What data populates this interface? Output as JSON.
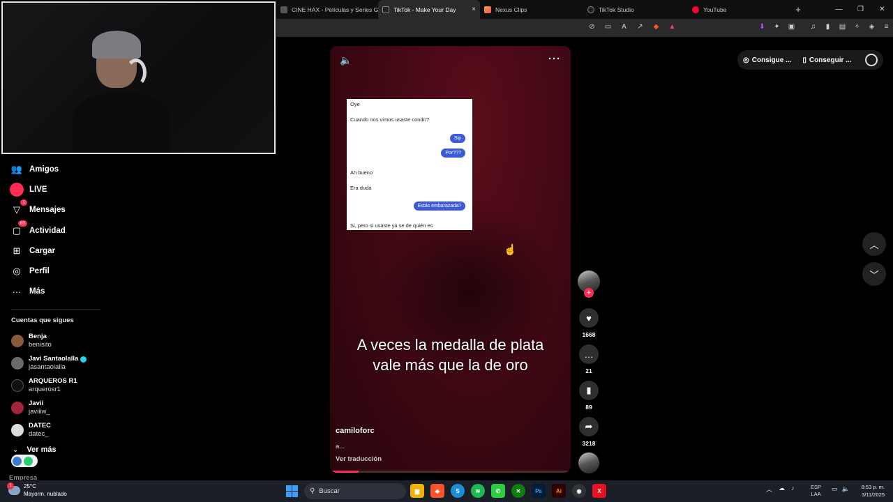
{
  "browser": {
    "tabs": [
      {
        "label": "CINE HAX - Películas y Series GRATIS",
        "icon": "cinehax-icon",
        "active": false
      },
      {
        "label": "TikTok - Make Your Day",
        "icon": "tiktok-icon",
        "active": true
      },
      {
        "label": "Nexus Clips",
        "icon": "nexus-icon",
        "active": false
      },
      {
        "label": "TikTok Studio",
        "icon": "tiktok-icon",
        "active": false
      },
      {
        "label": "YouTube",
        "icon": "youtube-icon",
        "active": false
      }
    ],
    "new_tab": "+",
    "close_tab": "×",
    "window_controls": [
      "—",
      "❐",
      "✕"
    ]
  },
  "sidebar": {
    "items": [
      {
        "label": "Amigos",
        "icon": "friends-icon",
        "badge": ""
      },
      {
        "label": "LIVE",
        "icon": "live-icon",
        "badge": ""
      },
      {
        "label": "Mensajes",
        "icon": "messages-icon",
        "badge": "1"
      },
      {
        "label": "Actividad",
        "icon": "activity-icon",
        "badge": "60"
      },
      {
        "label": "Cargar",
        "icon": "upload-icon",
        "badge": ""
      },
      {
        "label": "Perfil",
        "icon": "profile-icon",
        "badge": ""
      },
      {
        "label": "Más",
        "icon": "more-icon",
        "badge": ""
      }
    ],
    "following_title": "Cuentas que sigues",
    "following": [
      {
        "name": "Benja",
        "user": "benisito",
        "verified": false,
        "color": "#8b5a3c"
      },
      {
        "name": "Javi Santaolalla",
        "user": "jasantaolalla",
        "verified": true,
        "color": "#6a6a6a"
      },
      {
        "name": "ARQUEROS R1",
        "user": "arquerosr1",
        "verified": false,
        "color": "#111111"
      },
      {
        "name": "Javii",
        "user": "javiiiw_",
        "verified": false,
        "color": "#a3243a"
      },
      {
        "name": "DATEC",
        "user": "datec_",
        "verified": false,
        "color": "#dddddd"
      }
    ],
    "see_more": "Ver más",
    "empresa": "Empresa"
  },
  "video": {
    "chat": {
      "line1": "Oye",
      "line2": "Cuando nos vimos usaste condn?",
      "bubble1": "Sip",
      "bubble2": "Por???",
      "line3": "Ah bueno",
      "line4": "Era duda",
      "bubble3": "Estás embarazada?",
      "line5": "Si, pero si usaste ya se de quién es"
    },
    "caption": "A veces la medalla de plata vale más que la de oro",
    "author": "camiloforc",
    "description": "a...",
    "translate": "Ver traducción",
    "progress": 0.12,
    "accent": "#fe2c55"
  },
  "actions": {
    "likes": "1668",
    "comments": "21",
    "saves": "89",
    "shares": "3218"
  },
  "topbar": {
    "coins_label": "Consigue ...",
    "app_label": "Conseguir ..."
  },
  "taskbar": {
    "temp": "25°C",
    "weather": "Mayorm. nublado",
    "weather_badge": "1",
    "search": "Buscar",
    "lang1": "ESP",
    "lang2": "LAA",
    "time": "8:53 p. m.",
    "date": "3/11/2025"
  }
}
